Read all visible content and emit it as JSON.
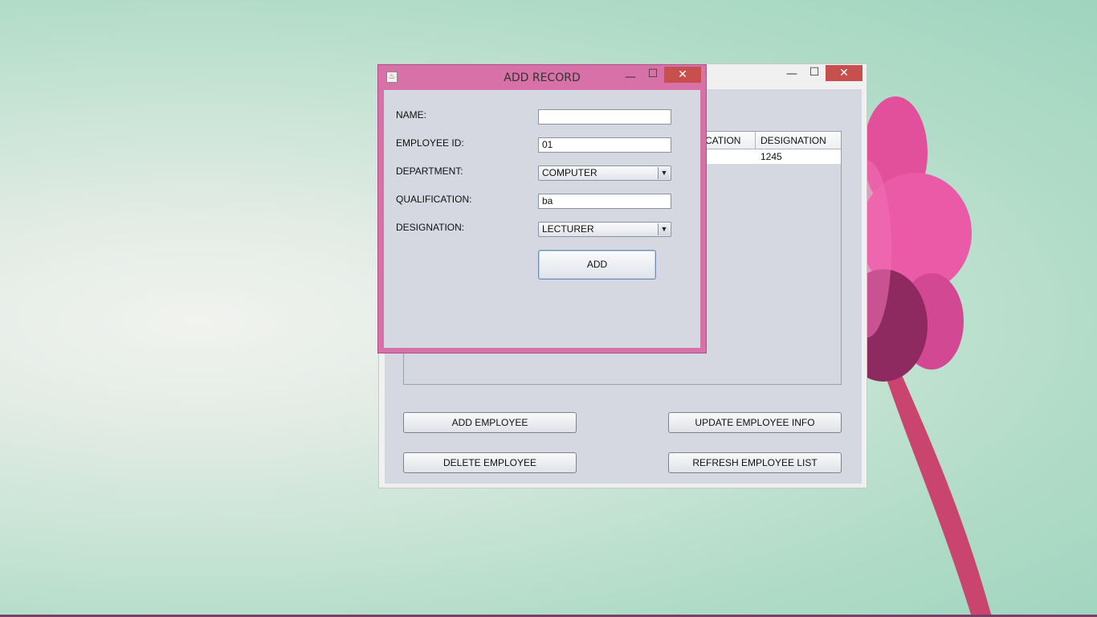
{
  "main_window": {
    "controls": {
      "minimize": "—",
      "maximize": "☐",
      "close": "✕"
    },
    "table": {
      "columns": [
        "CATION",
        "DESIGNATION"
      ],
      "rows": [
        [
          "",
          "1245"
        ]
      ]
    },
    "buttons": {
      "add_employee": "ADD EMPLOYEE",
      "update_employee": "UPDATE EMPLOYEE INFO",
      "delete_employee": "DELETE EMPLOYEE",
      "refresh_list": "REFRESH EMPLOYEE LIST"
    }
  },
  "dialog": {
    "title": "ADD RECORD",
    "controls": {
      "minimize": "—",
      "maximize": "☐",
      "close": "✕"
    },
    "app_icon": "java-icon",
    "fields": {
      "name": {
        "label": "NAME:",
        "value": ""
      },
      "employee_id": {
        "label": "EMPLOYEE ID:",
        "value": "01"
      },
      "department": {
        "label": "DEPARTMENT:",
        "value": "COMPUTER"
      },
      "qualification": {
        "label": "QUALIFICATION:",
        "value": "ba"
      },
      "designation": {
        "label": "DESIGNATION:",
        "value": "LECTURER"
      }
    },
    "add_label": "ADD"
  },
  "colors": {
    "dialog_frame": "#d771a7",
    "client_bg": "#d5d8e0",
    "close_button": "#c7504f"
  }
}
